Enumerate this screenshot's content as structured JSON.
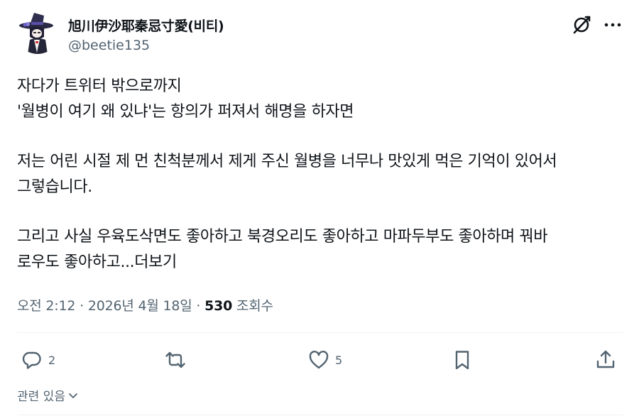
{
  "author": {
    "display_name": "旭川伊沙耶秦忌寸愛(비티)",
    "handle": "@beetie135",
    "avatar_icon": "avatar-witch-hat-character"
  },
  "header_actions": {
    "grok_icon": "grok-icon",
    "more_icon": "more-icon"
  },
  "tweet": {
    "lines": [
      "자다가 트위터 밖으로까지",
      "'월병이 여기 왜 있냐'는 항의가 퍼져서 해명을 하자면",
      "저는 어린 시절 제 먼 친척분께서 제게 주신 월병을 너무나 맛있게 먹은 기억이 있어서",
      "그렇습니다.",
      "그리고 사실 우육도삭면도 좋아하고 북경오리도 좋아하고 마파두부도 좋아하며 꿔바",
      "로우도 좋아하고..."
    ],
    "read_more": "더보기"
  },
  "meta": {
    "time": "오전 2:12",
    "separator": " · ",
    "date": "2026년 4월 18일",
    "views_count": "530",
    "views_label": " 조회수"
  },
  "actions": {
    "replies": "2",
    "likes": "5"
  },
  "related": {
    "label": "관련 있음"
  },
  "colors": {
    "text": "#0f1419",
    "secondary": "#536471",
    "divider": "#eff3f4",
    "icon": "#536471"
  }
}
